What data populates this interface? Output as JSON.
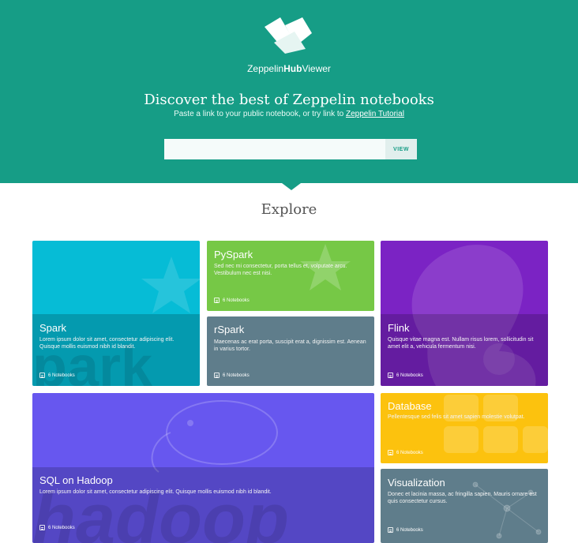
{
  "header": {
    "brand_prefix": "Zeppelin",
    "brand_bold": "Hub",
    "brand_suffix": "Viewer",
    "headline": "Discover the best of Zeppelin notebooks",
    "subline_text": "Paste a link to your public notebook, or try link to",
    "subline_link": "Zeppelin Tutorial",
    "search_value": "",
    "search_placeholder": "",
    "view_button": "VIEW",
    "color": "#169d86"
  },
  "explore_title": "Explore",
  "cards": [
    {
      "title": "Spark",
      "desc": "Lorem ipsum dolor sit amet, consectetur adipiscing elit. Quisque mollis euismod nibh id blandit.",
      "count": "6 Notebooks",
      "color": "#06bcd6"
    },
    {
      "title": "PySpark",
      "desc": "Sed nec mi consectetur, porta tellus et, volputate arcu. Vestibulum nec est nisi.",
      "count": "6 Notebooks",
      "color": "#76c846"
    },
    {
      "title": "Flink",
      "desc": "Quisque vitae magna est. Nullam risus lorem, sollicitudin sit amet elit a, vehicula fermentum nisi.",
      "count": "6 Notebooks",
      "color": "#7b23c4"
    },
    {
      "title": "rSpark",
      "desc": "Maecenas ac erat porta, suscipit erat a, dignissim est. Aenean in varius tortor.",
      "count": "6 Notebooks",
      "color": "#5f7d8b"
    },
    {
      "title": "SQL on Hadoop",
      "desc": "Lorem ipsum dolor sit amet, consectetur adipiscing elit. Quisque mollis euismod nibh id blandit.",
      "count": "6 Notebooks",
      "color": "#6757ef"
    },
    {
      "title": "Database",
      "desc": "Pellentesque sed felis sit amet sapien molestie volutpat.",
      "count": "6 Notebooks",
      "color": "#fcc20e"
    },
    {
      "title": "Visualization",
      "desc": "Donec et lacinia massa, ac fringilla sapien. Mauris ornare est quis consectetur cursus.",
      "count": "6 Notebooks",
      "color": "#5f7d8b"
    }
  ]
}
